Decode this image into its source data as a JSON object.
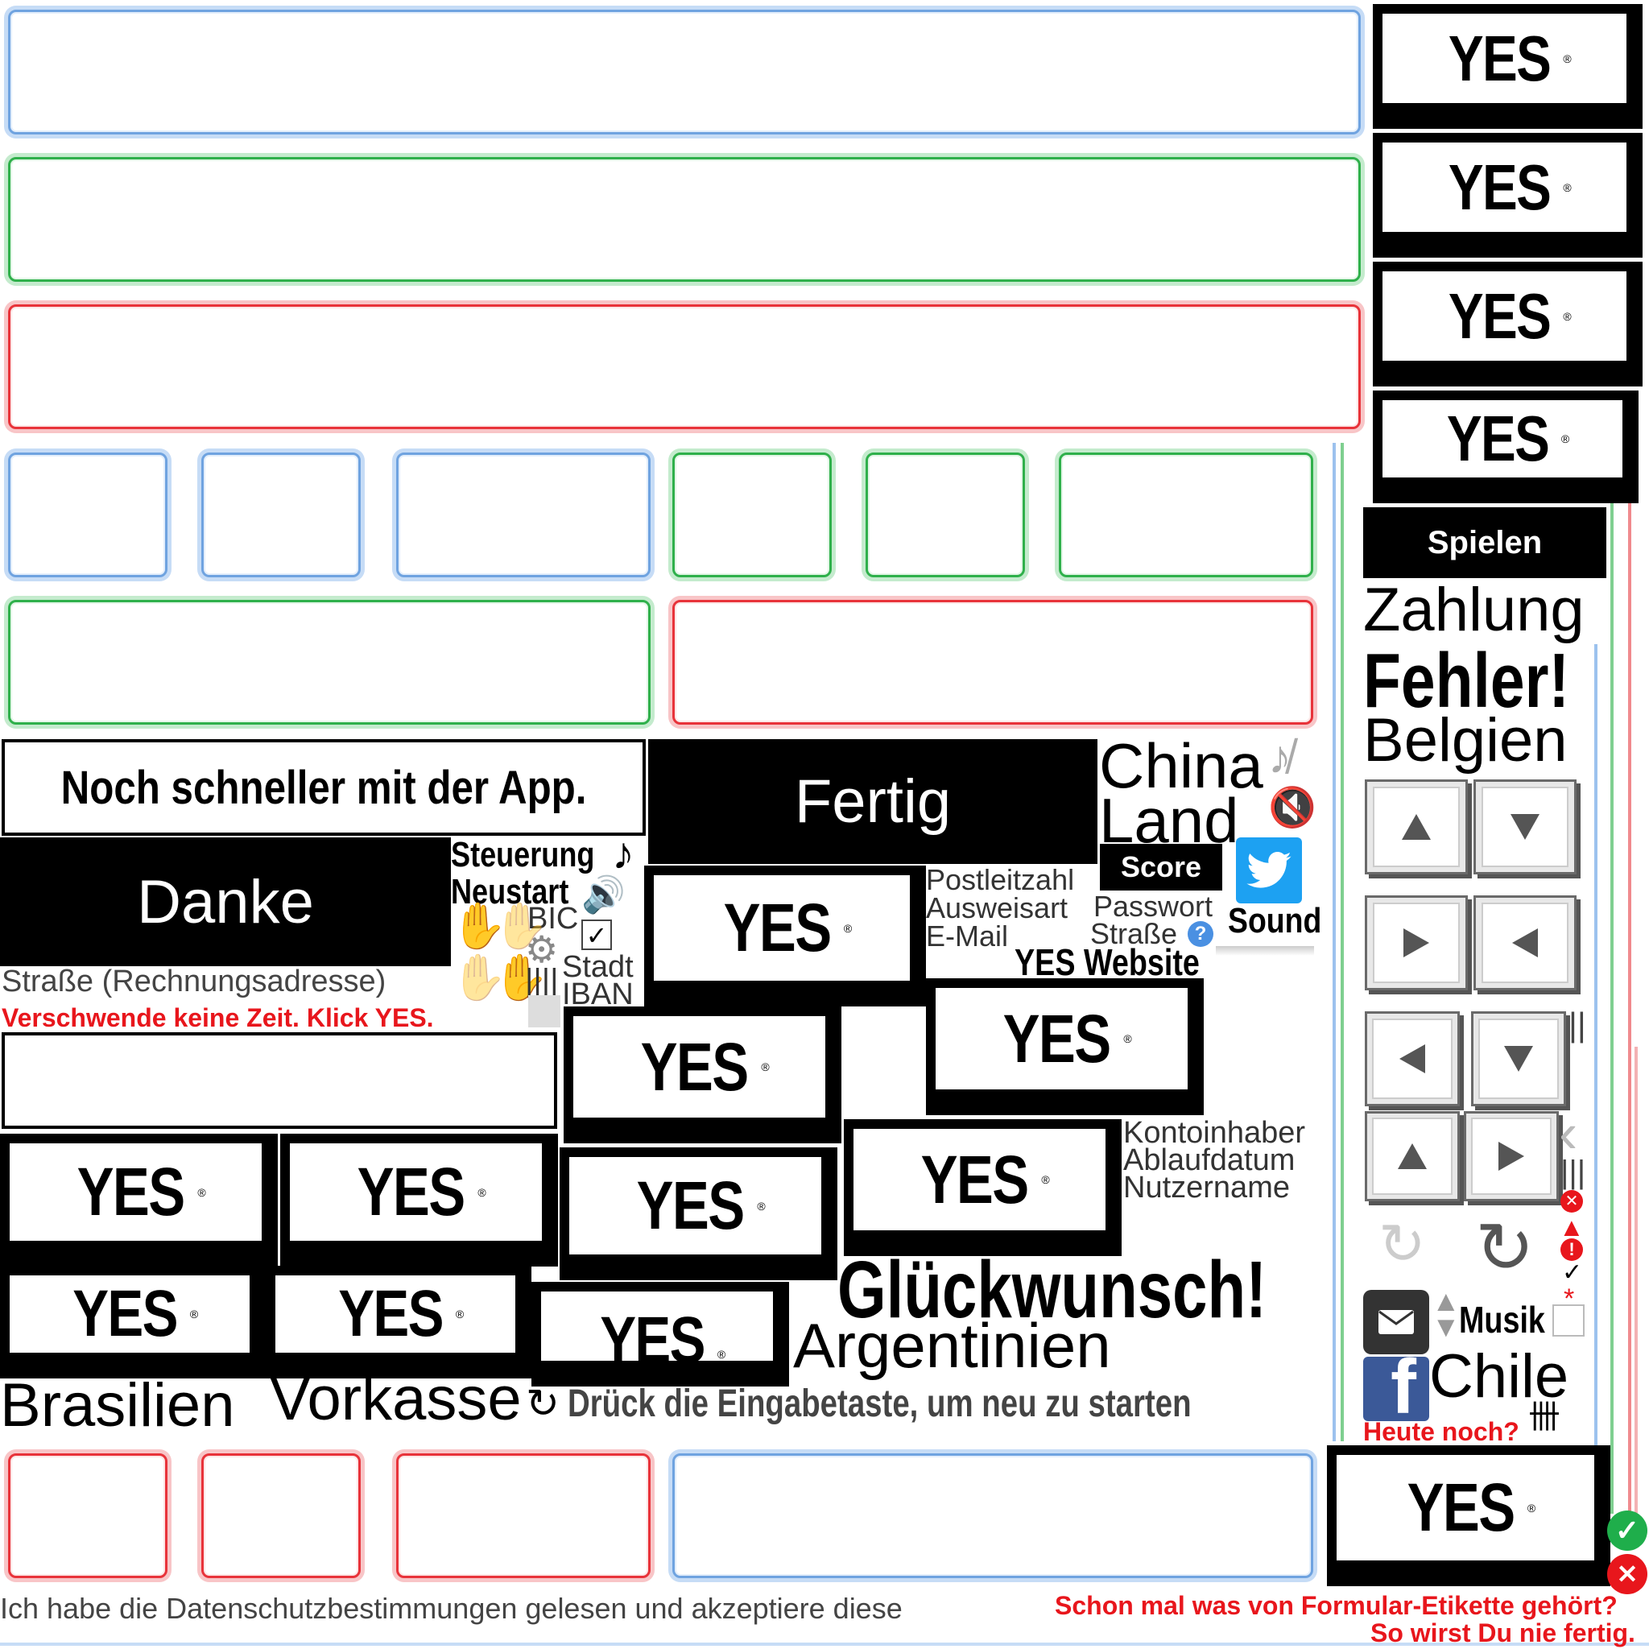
{
  "yes_button": {
    "label": "YES",
    "mark": "®"
  },
  "app_banner": "Noch schneller mit der App.",
  "fertig_button": "Fertig",
  "danke_button": "Danke",
  "spielen_button": "Spielen",
  "score_button": "Score",
  "labels": {
    "steuerung": "Steuerung",
    "neustart": "Neustart",
    "bic": "BIC",
    "stadt": "Stadt",
    "iban": "IBAN",
    "strasse_rechnung": "Straße (Rechnungsadresse)",
    "postleitzahl": "Postleitzahl",
    "ausweisart": "Ausweisart",
    "email": "E-Mail",
    "passwort": "Passwort",
    "strasse": "Straße",
    "sound": "Sound",
    "yes_website": "YES Website",
    "kontoinhaber": "Kontoinhaber",
    "ablaufdatum": "Ablaufdatum",
    "nutzername": "Nutzername",
    "musik": "Musik",
    "china": "China",
    "land": "Land",
    "zahlung": "Zahlung",
    "fehler": "Fehler!",
    "belgien": "Belgien",
    "glueckwunsch": "Glückwunsch!",
    "argentinien": "Argentinien",
    "brasilien": "Brasilien",
    "vorkasse": "Vorkasse",
    "chile": "Chile"
  },
  "messages": {
    "verschwende": "Verschwende keine Zeit. Klick YES.",
    "restart_hint": "Drück die Eingabetaste, um neu zu starten",
    "heute_noch": "Heute noch?",
    "datenschutz": "Ich habe die Datenschutzbestimmungen gelesen und akzeptiere diese",
    "etikette": "Schon mal was von Formular-Etikette gehört?",
    "nie_fertig": "So wirst Du nie fertig."
  },
  "glyphs": {
    "check": "✓",
    "checkmark_small": "✓",
    "asterisk": "*",
    "tally": "||||",
    "tally_five": "卌",
    "pause": "||",
    "chevron_left": "‹",
    "music_note": "♪",
    "speaker": "🔈",
    "bars": "|||"
  },
  "colors": {
    "blue_field": "#6fa3e0",
    "green_field": "#2fb04b",
    "red_field": "#e8333a",
    "error_text": "#e8161c",
    "twitter": "#1da1f2",
    "facebook": "#3b5998"
  }
}
